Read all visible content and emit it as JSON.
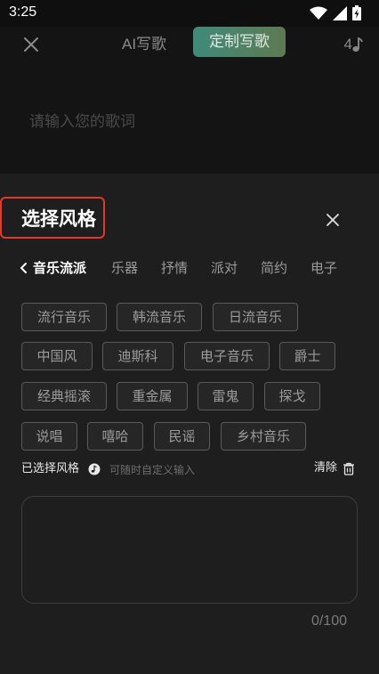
{
  "status_bar": {
    "time": "3:25"
  },
  "header": {
    "tab_ai": "AI写歌",
    "tab_custom": "定制写歌",
    "note_count": "4"
  },
  "editor": {
    "lyric_placeholder": "请输入您的歌词"
  },
  "sheet": {
    "title": "选择风格",
    "categories": [
      "音乐流派",
      "乐器",
      "抒情",
      "派对",
      "简约",
      "电子"
    ],
    "active_category": "音乐流派",
    "chips": [
      "流行音乐",
      "韩流音乐",
      "日流音乐",
      "中国风",
      "迪斯科",
      "电子音乐",
      "爵士",
      "经典摇滚",
      "重金属",
      "雷鬼",
      "探戈",
      "说唱",
      "嘻哈",
      "民谣",
      "乡村音乐"
    ],
    "selected_label": "已选择风格",
    "selected_hint": "可随时自定义输入",
    "clear_label": "清除",
    "input_value": "",
    "counter": "0/100"
  },
  "colors": {
    "background": "#111111",
    "sheet": "#1e1e1e",
    "accent_start": "#3f8a7a",
    "accent_end": "#5e7a52",
    "highlight_border": "#e0392d"
  }
}
